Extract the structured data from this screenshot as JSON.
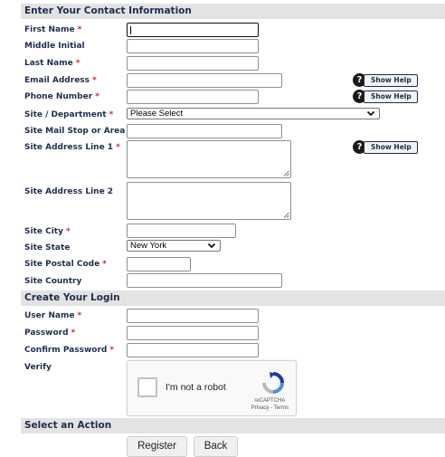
{
  "sections": {
    "contact": "Enter Your Contact Information",
    "login": "Create Your Login",
    "action": "Select an Action"
  },
  "required_marker": "*",
  "fields": {
    "first_name": "First Name",
    "middle_initial": "Middle Initial",
    "last_name": "Last Name",
    "email": "Email Address",
    "phone": "Phone Number",
    "site_department": "Site / Department",
    "site_mail_stop": "Site Mail Stop or Area",
    "site_address_1": "Site Address Line 1",
    "site_address_2": "Site Address Line 2",
    "site_city": "Site City",
    "site_state": "Site State",
    "site_postal_code": "Site Postal Code",
    "site_country": "Site Country",
    "user_name": "User Name",
    "password": "Password",
    "confirm_password": "Confirm Password",
    "verify": "Verify"
  },
  "values": {
    "site_department": "Please Select",
    "site_state": "New York"
  },
  "help": {
    "icon_text": "?",
    "label": "Show Help"
  },
  "captcha": {
    "label": "I'm not a robot",
    "brand": "reCAPTCHA",
    "links": "Privacy - Terms"
  },
  "buttons": {
    "register": "Register",
    "back": "Back"
  },
  "colors": {
    "label": "#1f2d4d",
    "required": "#e0203a",
    "section_bg": "#e3e3e3"
  }
}
